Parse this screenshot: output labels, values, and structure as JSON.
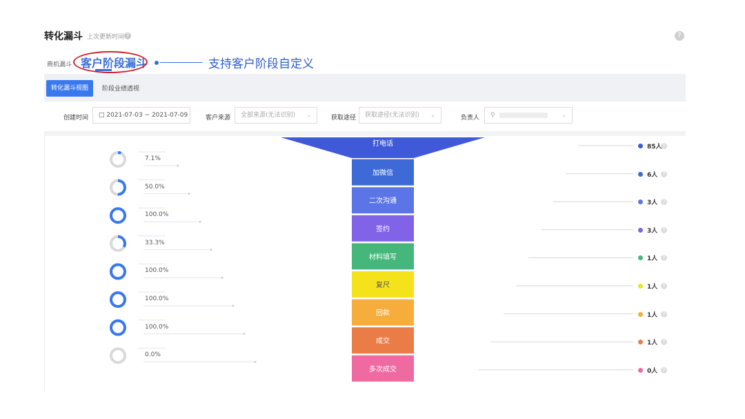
{
  "header": {
    "title": "转化漏斗",
    "subtitle": "上次更新时间",
    "help_glyph": "?"
  },
  "tabs": {
    "label": "商机漏斗",
    "active": "客户阶段漏斗"
  },
  "annotation": "支持客户阶段自定义",
  "subtabs": {
    "primary": "转化漏斗视图",
    "secondary": "阶段业绩透视"
  },
  "filters": {
    "created_label": "创建时间",
    "date_range": "2021-07-03 ~ 2021-07-09",
    "source_label": "客户来源",
    "source_value": "全部来源(无法识别)",
    "channel_label": "获取途径",
    "channel_value": "获取途径(无法识别)",
    "owner_label": "负责人",
    "owner_placeholder": ""
  },
  "icons": {
    "help": "question-circle-icon",
    "calendar": "calendar-icon",
    "chevron": "chevron-down-icon",
    "search": "search-icon"
  },
  "chart_data": {
    "type": "funnel",
    "stages": [
      {
        "name": "打电话",
        "count": "85人",
        "value": 85,
        "color": "#3f59d9"
      },
      {
        "name": "加微信",
        "count": "6人",
        "value": 6,
        "color": "#3d6ad6"
      },
      {
        "name": "二次沟通",
        "count": "3人",
        "value": 3,
        "color": "#5b75e6"
      },
      {
        "name": "签约",
        "count": "3人",
        "value": 3,
        "color": "#8063e6"
      },
      {
        "name": "材料填写",
        "count": "1人",
        "value": 1,
        "color": "#45b77b"
      },
      {
        "name": "复尺",
        "count": "1人",
        "value": 1,
        "color": "#f4e31a"
      },
      {
        "name": "回款",
        "count": "1人",
        "value": 1,
        "color": "#f6ad3c"
      },
      {
        "name": "成交",
        "count": "1人",
        "value": 1,
        "color": "#ea7c48"
      },
      {
        "name": "多次成交",
        "count": "0人",
        "value": 0,
        "color": "#ef6aa0"
      }
    ],
    "conversion_rates": [
      {
        "label": "7.1%",
        "value": 7.1
      },
      {
        "label": "50.0%",
        "value": 50.0
      },
      {
        "label": "100.0%",
        "value": 100.0
      },
      {
        "label": "33.3%",
        "value": 33.3
      },
      {
        "label": "100.0%",
        "value": 100.0
      },
      {
        "label": "100.0%",
        "value": 100.0
      },
      {
        "label": "100.0%",
        "value": 100.0
      },
      {
        "label": "0.0%",
        "value": 0.0
      }
    ],
    "ring_color": "#3a78ee",
    "ring_track_color": "#d9d9d9"
  }
}
